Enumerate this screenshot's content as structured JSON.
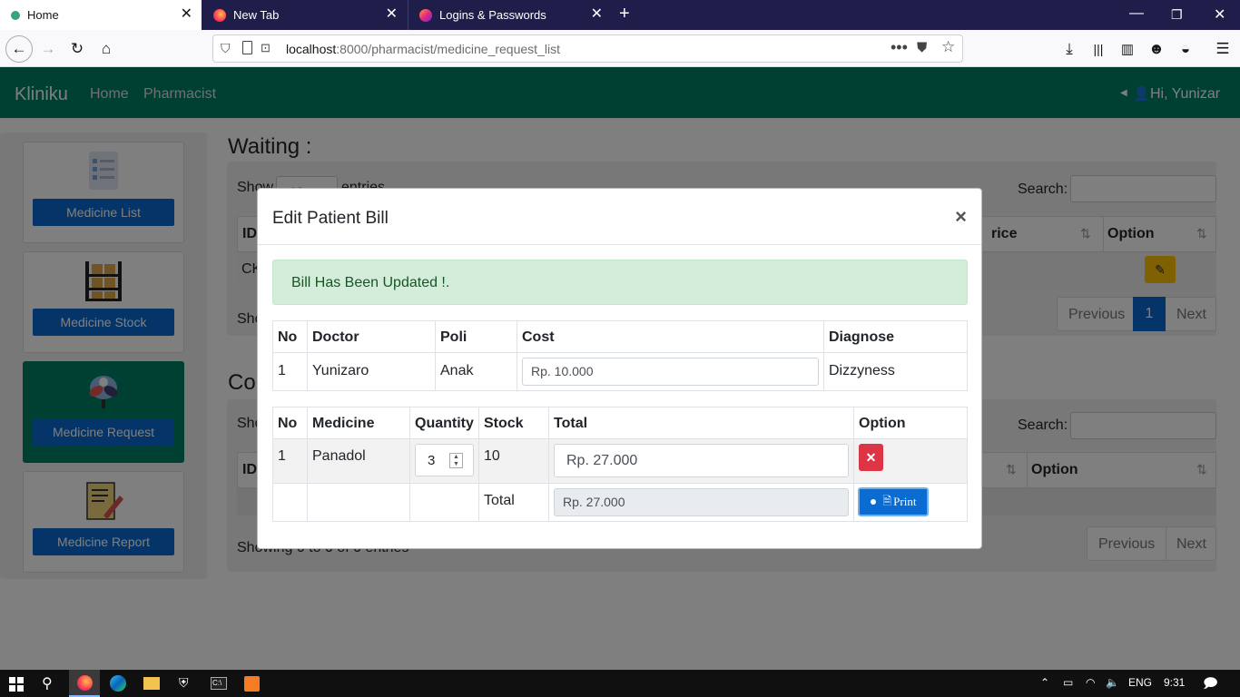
{
  "browser": {
    "tabs": [
      {
        "label": "Home",
        "active": true,
        "icon": "kliniku-favicon"
      },
      {
        "label": "New Tab",
        "active": false,
        "icon": "firefox-icon"
      },
      {
        "label": "Logins & Passwords",
        "active": false,
        "icon": "lockwise-icon"
      }
    ],
    "url_host": "localhost",
    "url_path": ":8000/pharmacist/medicine_request_list",
    "nav_icons": [
      "back-icon",
      "forward-icon",
      "reload-icon",
      "home-icon"
    ],
    "toolbar_icons": [
      "download-icon",
      "library-icon",
      "sidebar-icon",
      "account-icon",
      "sync-icon",
      "menu-icon"
    ]
  },
  "app": {
    "brand": "Kliniku",
    "nav": [
      "Home",
      "Pharmacist"
    ],
    "user_greeting": "Hi, Yunizar",
    "colors": {
      "primary": "#008066",
      "button": "#0a6bd1"
    }
  },
  "sidebar": {
    "items": [
      {
        "label": "Medicine List",
        "icon": "checklist-icon",
        "active": false
      },
      {
        "label": "Medicine Stock",
        "icon": "shelf-icon",
        "active": false
      },
      {
        "label": "Medicine Request",
        "icon": "pills-icon",
        "active": true
      },
      {
        "label": "Medicine Report",
        "icon": "report-icon",
        "active": false
      }
    ]
  },
  "waiting": {
    "title": "Waiting :",
    "show_prefix": "Show",
    "show_suffix": "entries",
    "show_value": "10",
    "search_label": "Search:",
    "col_id": "ID",
    "col_price": "rice",
    "col_option": "Option",
    "row_id": "CK",
    "showing": "Sho",
    "pagination": {
      "prev": "Previous",
      "page": "1",
      "next": "Next"
    }
  },
  "completed": {
    "title": "Cor",
    "show_prefix": "Sho",
    "search_label": "Search:",
    "col_id": "ID",
    "col_option": "Option",
    "showing": "Showing 0 to 0 of 0 entries",
    "pagination": {
      "prev": "Previous",
      "next": "Next"
    }
  },
  "modal": {
    "title": "Edit Patient Bill",
    "close": "×",
    "alert": "Bill Has Been Updated !.",
    "bill_table": {
      "headers": [
        "No",
        "Doctor",
        "Poli",
        "Cost",
        "Diagnose"
      ],
      "row": {
        "no": "1",
        "doctor": "Yunizaro",
        "poli": "Anak",
        "cost": "Rp. 10.000",
        "diagnose": "Dizzyness"
      }
    },
    "med_table": {
      "headers": [
        "No",
        "Medicine",
        "Quantity",
        "Stock",
        "Total",
        "Option"
      ],
      "row": {
        "no": "1",
        "medicine": "Panadol",
        "quantity": "3",
        "stock": "10",
        "total": "Rp. 27.000"
      },
      "total_label": "Total",
      "grand_total": "Rp. 27.000",
      "print_label": "Print"
    }
  },
  "taskbar": {
    "lang": "ENG",
    "time": "9:31"
  }
}
